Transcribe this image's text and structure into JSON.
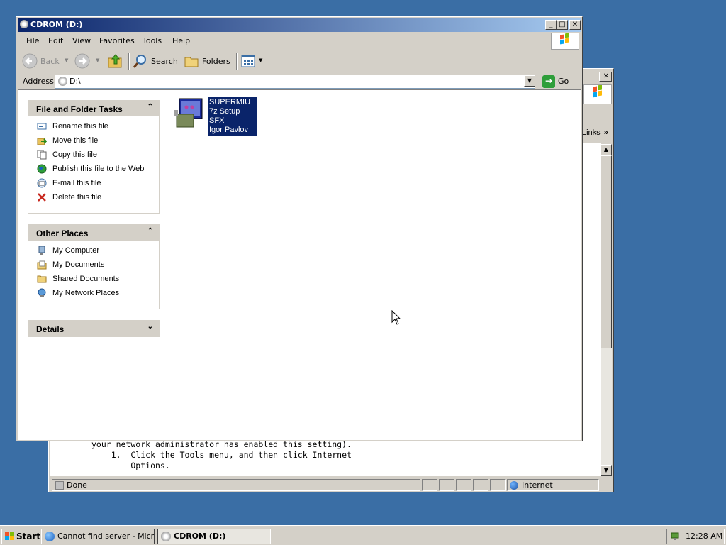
{
  "ie": {
    "links_label": "Links",
    "body_lines": [
      "your network administrator has enabled this setting).",
      "    1.  Click the Tools menu, and then click Internet",
      "        Options."
    ],
    "status_text": "Done",
    "zone_label": "Internet"
  },
  "explorer": {
    "title": "CDROM (D:)",
    "menu": [
      "File",
      "Edit",
      "View",
      "Favorites",
      "Tools",
      "Help"
    ],
    "toolbar": {
      "back_label": "Back",
      "search_label": "Search",
      "folders_label": "Folders"
    },
    "address": {
      "label": "Address",
      "value": "D:\\",
      "go_label": "Go"
    },
    "file_tasks": {
      "title": "File and Folder Tasks",
      "items": [
        {
          "label": "Rename this file",
          "icon": "rename-icon"
        },
        {
          "label": "Move this file",
          "icon": "move-icon"
        },
        {
          "label": "Copy this file",
          "icon": "copy-icon"
        },
        {
          "label": "Publish this file to the Web",
          "icon": "globe-icon"
        },
        {
          "label": "E-mail this file",
          "icon": "email-icon"
        },
        {
          "label": "Delete this file",
          "icon": "delete-icon"
        }
      ]
    },
    "other_places": {
      "title": "Other Places",
      "items": [
        {
          "label": "My Computer",
          "icon": "computer-icon"
        },
        {
          "label": "My Documents",
          "icon": "documents-icon"
        },
        {
          "label": "Shared Documents",
          "icon": "folder-icon"
        },
        {
          "label": "My Network Places",
          "icon": "network-icon"
        }
      ]
    },
    "details": {
      "title": "Details"
    },
    "file": {
      "name": "SUPERMIU",
      "type": "7z Setup SFX",
      "company": "Igor Pavlov"
    }
  },
  "taskbar": {
    "start_label": "Start",
    "tasks": [
      {
        "label": "Cannot find server - Micr..."
      },
      {
        "label": "CDROM (D:)"
      }
    ],
    "clock": "12:28 AM"
  },
  "colors": {
    "desktop": "#3a6ea5",
    "title_active": "#0a246a",
    "selection": "#0a246a"
  }
}
